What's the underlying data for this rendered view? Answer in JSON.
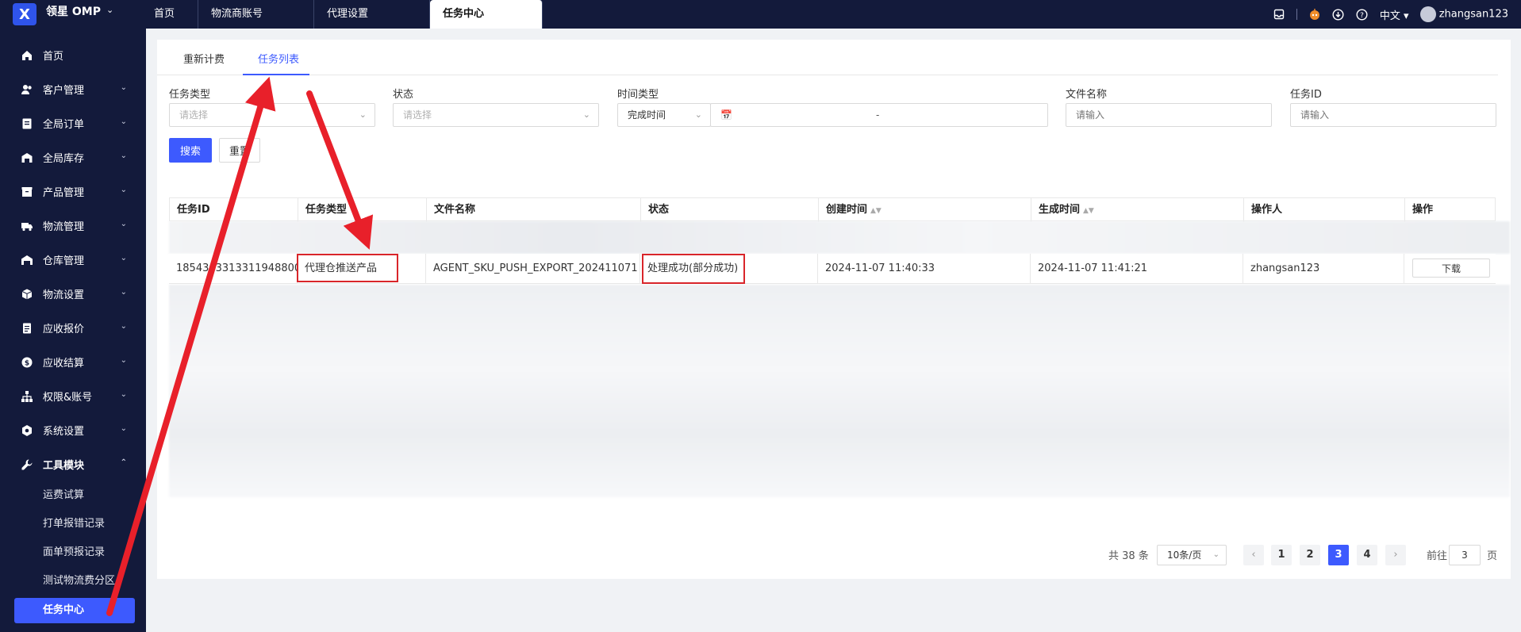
{
  "app": {
    "logo_glyph": "X",
    "brand": "领星 OMP"
  },
  "top_tabs": [
    {
      "label": "首页"
    },
    {
      "label": "物流商账号"
    },
    {
      "label": "代理设置"
    },
    {
      "label": "任务中心"
    }
  ],
  "top_right": {
    "language": "中文",
    "username": "zhangsan123"
  },
  "sidebar": {
    "items": [
      {
        "label": "首页",
        "icon": "home-icon"
      },
      {
        "label": "客户管理",
        "icon": "users-icon"
      },
      {
        "label": "全局订单",
        "icon": "order-icon"
      },
      {
        "label": "全局库存",
        "icon": "inventory-icon"
      },
      {
        "label": "产品管理",
        "icon": "box-icon"
      },
      {
        "label": "物流管理",
        "icon": "truck-icon"
      },
      {
        "label": "仓库管理",
        "icon": "warehouse-icon"
      },
      {
        "label": "物流设置",
        "icon": "cube-icon"
      },
      {
        "label": "应收报价",
        "icon": "document-icon"
      },
      {
        "label": "应收结算",
        "icon": "dollar-icon"
      },
      {
        "label": "权限&账号",
        "icon": "org-icon"
      },
      {
        "label": "系统设置",
        "icon": "settings-icon"
      },
      {
        "label": "工具模块",
        "icon": "wrench-icon"
      }
    ],
    "sub_items": [
      {
        "label": "运费试算"
      },
      {
        "label": "打单报错记录"
      },
      {
        "label": "面单预报记录"
      },
      {
        "label": "测试物流费分区"
      },
      {
        "label": "任务中心"
      }
    ]
  },
  "sub_tabs": [
    {
      "label": "重新计费"
    },
    {
      "label": "任务列表"
    }
  ],
  "filters": {
    "task_type": {
      "label": "任务类型",
      "placeholder": "请选择"
    },
    "status": {
      "label": "状态",
      "placeholder": "请选择"
    },
    "time_type": {
      "label": "时间类型",
      "value": "完成时间",
      "range_sep": "-"
    },
    "file_name": {
      "label": "文件名称",
      "placeholder": "请输入"
    },
    "task_id": {
      "label": "任务ID",
      "placeholder": "请输入"
    },
    "search_label": "搜索",
    "reset_label": "重置"
  },
  "table": {
    "columns": [
      "任务ID",
      "任务类型",
      "文件名称",
      "状态",
      "创建时间",
      "生成时间",
      "操作人",
      "操作"
    ],
    "row": {
      "task_id": "1854363313311948800",
      "task_type": "代理仓推送产品",
      "file_name": "AGENT_SKU_PUSH_EXPORT_202411071",
      "status": "处理成功(部分成功)",
      "created": "2024-11-07 11:40:33",
      "generated": "2024-11-07 11:41:21",
      "operator": "zhangsan123",
      "action": "下载"
    }
  },
  "pagination": {
    "total": "共 38 条",
    "page_size": "10条/页",
    "pages": [
      "1",
      "2",
      "3",
      "4"
    ],
    "current": "3",
    "goto_label": "前往",
    "goto_value": "3",
    "page_suffix": "页"
  },
  "colors": {
    "accent": "#3d5afe",
    "sidebar_bg": "#131a3b",
    "annotation": "#e8202a"
  }
}
